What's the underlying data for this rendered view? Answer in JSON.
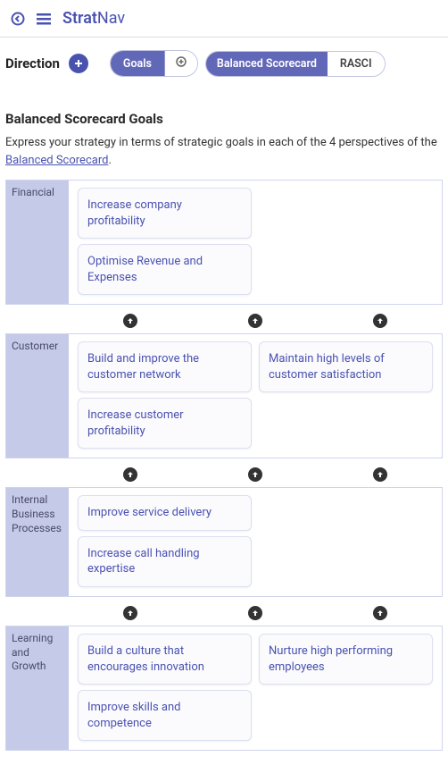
{
  "app": {
    "name_strong": "Strat",
    "name_light": "Nav"
  },
  "toolbar": {
    "direction_label": "Direction",
    "goals_btn": "Goals",
    "balanced_btn": "Balanced Scorecard",
    "rasci_btn": "RASCI"
  },
  "page": {
    "title": "Balanced Scorecard Goals",
    "desc_pre": "Express your strategy in terms of strategic goals in each of the 4 perspectives of the ",
    "desc_link": "Balanced Scorecard",
    "desc_post": "."
  },
  "perspectives": [
    {
      "id": "financial",
      "label": "Financial",
      "rows": [
        [
          {
            "text": "Increase company profitability"
          }
        ],
        [
          {
            "text": "Optimise Revenue and Expenses"
          }
        ]
      ]
    },
    {
      "id": "customer",
      "label": "Customer",
      "rows": [
        [
          {
            "text": "Build and improve the customer network"
          },
          {
            "text": "Maintain high levels of customer satisfaction"
          }
        ],
        [
          {
            "text": "Increase customer profitability"
          }
        ]
      ]
    },
    {
      "id": "internal",
      "label": "Internal Business Processes",
      "rows": [
        [
          {
            "text": "Improve service delivery"
          }
        ],
        [
          {
            "text": "Increase call handling expertise"
          }
        ]
      ]
    },
    {
      "id": "learning",
      "label": "Learning and Growth",
      "rows": [
        [
          {
            "text": "Build a culture that encourages innovation"
          },
          {
            "text": "Nurture high performing employees"
          }
        ],
        [
          {
            "text": "Improve skills and competence"
          }
        ]
      ]
    }
  ]
}
